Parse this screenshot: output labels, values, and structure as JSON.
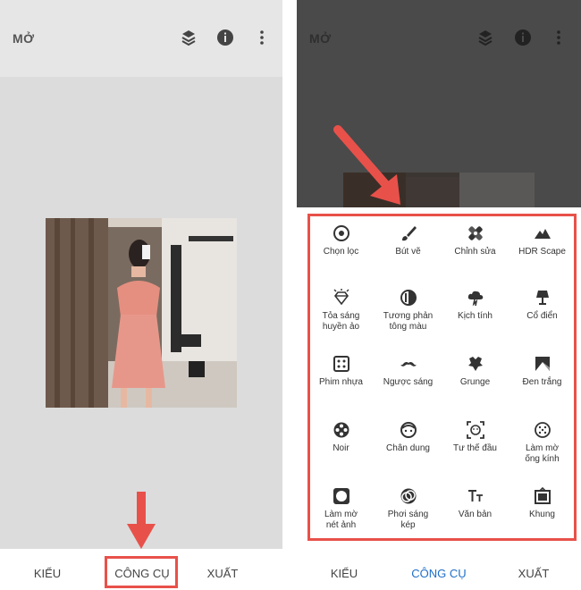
{
  "left": {
    "title": "MỞ",
    "tabs": [
      {
        "label": "KIỂU"
      },
      {
        "label": "CÔNG CỤ"
      },
      {
        "label": "XUẤT"
      }
    ]
  },
  "right": {
    "title": "MỞ",
    "tabs": [
      {
        "label": "KIỂU"
      },
      {
        "label": "CÔNG CỤ"
      },
      {
        "label": "XUẤT"
      }
    ],
    "tools": [
      {
        "label": "Chọn lọc",
        "icon": "target-icon"
      },
      {
        "label": "Bút vẽ",
        "icon": "brush-icon"
      },
      {
        "label": "Chỉnh sửa",
        "icon": "bandage-icon"
      },
      {
        "label": "HDR Scape",
        "icon": "mountain-icon"
      },
      {
        "label": "Tỏa sáng\nhuyền ảo",
        "icon": "diamond-glow-icon"
      },
      {
        "label": "Tương phản\ntông màu",
        "icon": "tonal-contrast-icon"
      },
      {
        "label": "Kịch tính",
        "icon": "cloud-storm-icon"
      },
      {
        "label": "Cổ điển",
        "icon": "lamp-icon"
      },
      {
        "label": "Phim nhựa",
        "icon": "dice-icon"
      },
      {
        "label": "Ngược sáng",
        "icon": "mustache-icon"
      },
      {
        "label": "Grunge",
        "icon": "grunge-icon"
      },
      {
        "label": "Đen trắng",
        "icon": "bw-mountain-icon"
      },
      {
        "label": "Noir",
        "icon": "film-reel-icon"
      },
      {
        "label": "Chân dung",
        "icon": "face-icon"
      },
      {
        "label": "Tư thế đầu",
        "icon": "face-frame-icon"
      },
      {
        "label": "Làm mờ\nống kính",
        "icon": "lens-blur-icon"
      },
      {
        "label": "Làm mờ\nnét ảnh",
        "icon": "vignette-icon"
      },
      {
        "label": "Phơi sáng\nkép",
        "icon": "double-exposure-icon"
      },
      {
        "label": "Văn bản",
        "icon": "text-icon"
      },
      {
        "label": "Khung",
        "icon": "frame-icon"
      }
    ]
  },
  "colors": {
    "highlight": "#e8514a",
    "active_tab": "#1e6fc9"
  }
}
